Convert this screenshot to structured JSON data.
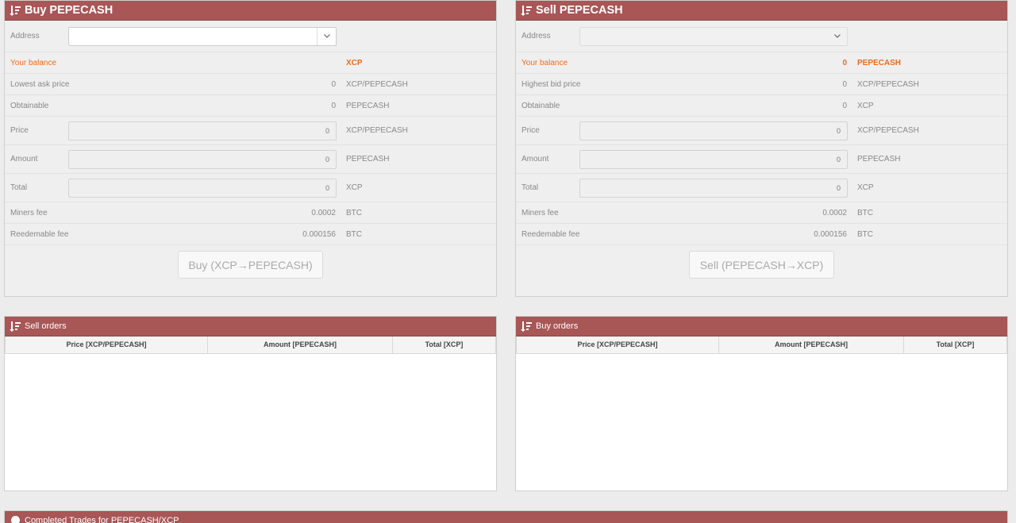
{
  "buy_panel": {
    "title": "Buy PEPECASH",
    "rows": {
      "address_label": "Address",
      "balance_label": "Your balance",
      "balance_value": "",
      "balance_unit": "XCP",
      "price_label": "Lowest ask price",
      "price_value": "0",
      "price_unit": "XCP/PEPECASH",
      "obtainable_label": "Obtainable",
      "obtainable_value": "0",
      "obtainable_unit": "PEPECASH",
      "input_price_label": "Price",
      "input_price_value": "0",
      "input_price_unit": "XCP/PEPECASH",
      "amount_label": "Amount",
      "amount_value": "0",
      "amount_unit": "PEPECASH",
      "total_label": "Total",
      "total_value": "0",
      "total_unit": "XCP",
      "miners_fee_label": "Miners fee",
      "miners_fee_value": "0.0002",
      "miners_fee_unit": "BTC",
      "redeemable_fee_label": "Reedemable fee",
      "redeemable_fee_value": "0.000156",
      "redeemable_fee_unit": "BTC"
    },
    "button_label": "Buy (XCP→PEPECASH)"
  },
  "sell_panel": {
    "title": "Sell PEPECASH",
    "rows": {
      "address_label": "Address",
      "balance_label": "Your balance",
      "balance_value": "0",
      "balance_unit": "PEPECASH",
      "price_label": "Highest bid price",
      "price_value": "0",
      "price_unit": "XCP/PEPECASH",
      "obtainable_label": "Obtainable",
      "obtainable_value": "0",
      "obtainable_unit": "XCP",
      "input_price_label": "Price",
      "input_price_value": "0",
      "input_price_unit": "XCP/PEPECASH",
      "amount_label": "Amount",
      "amount_value": "0",
      "amount_unit": "PEPECASH",
      "total_label": "Total",
      "total_value": "0",
      "total_unit": "XCP",
      "miners_fee_label": "Miners fee",
      "miners_fee_value": "0.0002",
      "miners_fee_unit": "BTC",
      "redeemable_fee_label": "Reedemable fee",
      "redeemable_fee_value": "0.000156",
      "redeemable_fee_unit": "BTC"
    },
    "button_label": "Sell (PEPECASH→XCP)"
  },
  "sell_orders": {
    "title": "Sell orders",
    "columns": [
      "Price [XCP/PEPECASH]",
      "Amount [PEPECASH]",
      "Total [XCP]"
    ]
  },
  "buy_orders": {
    "title": "Buy orders",
    "columns": [
      "Price [XCP/PEPECASH]",
      "Amount [PEPECASH]",
      "Total [XCP]"
    ]
  },
  "completed_trades": {
    "title": "Completed Trades for PEPECASH/XCP"
  },
  "colors": {
    "header_bg": "#a85656",
    "accent_orange": "#f06b1a",
    "panel_bg": "#efefef"
  }
}
